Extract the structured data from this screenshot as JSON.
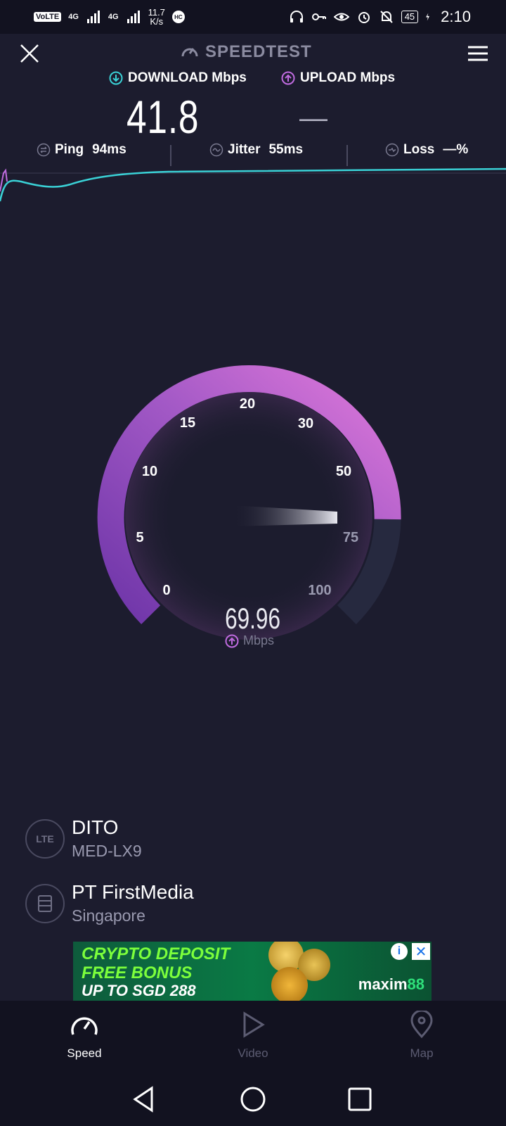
{
  "status_bar": {
    "volte": "VoLTE",
    "network_1": "4G",
    "network_2": "4G",
    "net_speed_value": "11.7",
    "net_speed_unit": "K/s",
    "hc": "HC",
    "battery": "45",
    "time": "2:10"
  },
  "header": {
    "title": "SPEEDTEST"
  },
  "metrics": {
    "download_label": "DOWNLOAD Mbps",
    "upload_label": "UPLOAD Mbps",
    "download_value": "41.8",
    "upload_value": "—"
  },
  "stats": {
    "ping_label": "Ping",
    "ping_value": "94ms",
    "jitter_label": "Jitter",
    "jitter_value": "55ms",
    "loss_label": "Loss",
    "loss_value": "—%"
  },
  "gauge": {
    "ticks": [
      "0",
      "5",
      "10",
      "15",
      "20",
      "30",
      "50",
      "75",
      "100"
    ],
    "value": "69.96",
    "unit": "Mbps",
    "arc_color_start": "#7a3fb0",
    "arc_color_end": "#d070d8"
  },
  "connection": {
    "carrier": "DITO",
    "device": "MED-LX9",
    "carrier_icon": "LTE",
    "provider": "PT FirstMedia",
    "location": "Singapore"
  },
  "ad": {
    "line1": "CRYPTO DEPOSIT",
    "line2": "FREE BONUS",
    "line3": "UP TO SGD 288",
    "brand": "maxim",
    "brand_suffix": "88"
  },
  "tabs": {
    "speed": "Speed",
    "video": "Video",
    "map": "Map"
  },
  "colors": {
    "background": "#1c1c2e",
    "accent_download": "#3ad1d6",
    "accent_upload": "#c06be0"
  }
}
